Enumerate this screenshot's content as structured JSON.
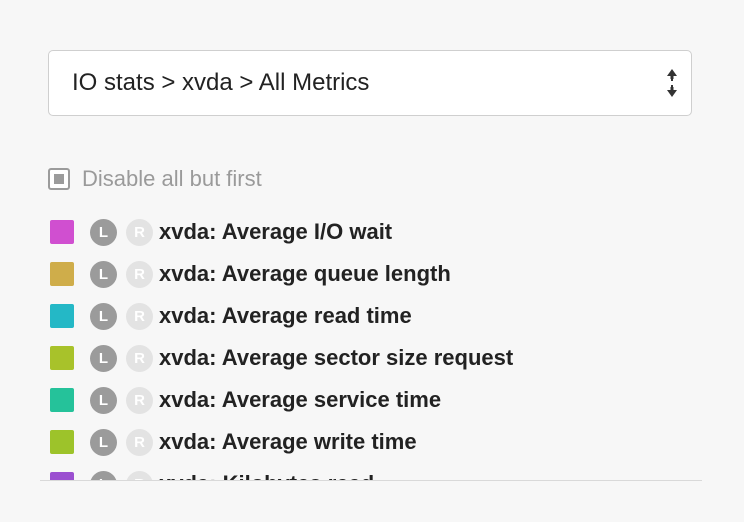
{
  "selector": {
    "value": "IO stats > xvda > All Metrics"
  },
  "options": {
    "disable_all_label": "Disable all but first"
  },
  "metrics": [
    {
      "color": "#d04fd0",
      "left_label": "L",
      "right_label": "R",
      "label": "xvda: Average I/O wait"
    },
    {
      "color": "#cfad4a",
      "left_label": "L",
      "right_label": "R",
      "label": "xvda: Average queue length"
    },
    {
      "color": "#24b8c6",
      "left_label": "L",
      "right_label": "R",
      "label": "xvda: Average read time"
    },
    {
      "color": "#a8c22a",
      "left_label": "L",
      "right_label": "R",
      "label": "xvda: Average sector size request"
    },
    {
      "color": "#25c29a",
      "left_label": "L",
      "right_label": "R",
      "label": "xvda: Average service time"
    },
    {
      "color": "#9dc32a",
      "left_label": "L",
      "right_label": "R",
      "label": "xvda: Average write time"
    },
    {
      "color": "#9b4fd0",
      "left_label": "L",
      "right_label": "R",
      "label": "xvda: Kilobytes read"
    }
  ]
}
